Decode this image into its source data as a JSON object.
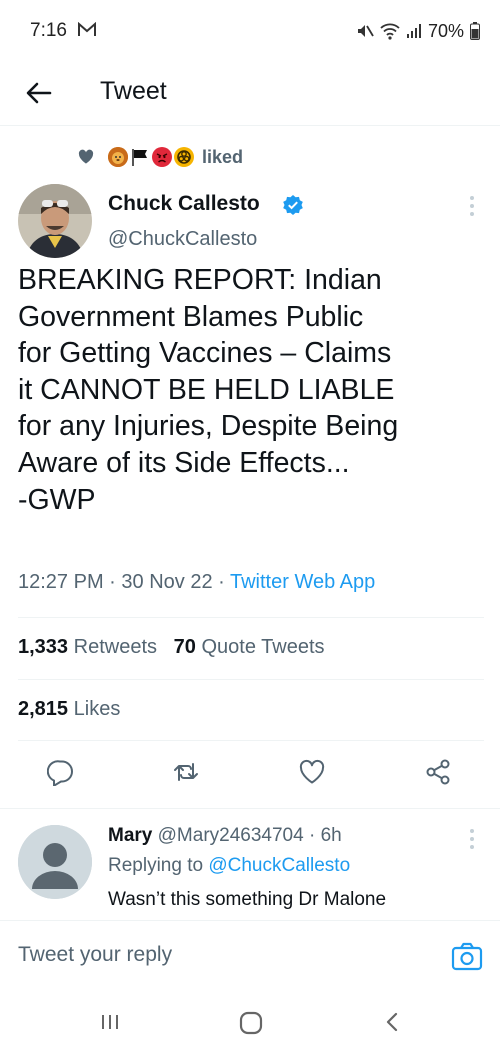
{
  "status_bar": {
    "time": "7:16",
    "battery": "70%",
    "icons": [
      "gmail-icon",
      "mute-icon",
      "wifi-icon",
      "signal-icon",
      "battery-icon"
    ]
  },
  "header": {
    "title": "Tweet",
    "back_icon": "arrow-left-icon"
  },
  "social_context": {
    "text": "liked",
    "emojis": [
      "lion-face",
      "black-flag",
      "angry-face",
      "biohazard-sign"
    ]
  },
  "tweet": {
    "author_name": "Chuck Callesto",
    "author_handle": "@ChuckCallesto",
    "verified": true,
    "text": "BREAKING REPORT: Indian\nGovernment Blames Public\nfor Getting Vaccines – Claims\nit CANNOT BE HELD LIABLE\nfor any Injuries, Despite Being\nAware of its Side Effects...\n-GWP",
    "time": "12:27 PM",
    "date": "30 Nov 22",
    "source": "Twitter Web App",
    "retweets_count": "1,333",
    "retweets_label": "Retweets",
    "quotes_count": "70",
    "quotes_label": "Quote Tweets",
    "likes_count": "2,815",
    "likes_label": "Likes"
  },
  "actions": [
    "reply-icon",
    "retweet-icon",
    "like-icon",
    "share-icon"
  ],
  "reply": {
    "name": "Mary",
    "handle": "@Mary24634704",
    "time": "6h",
    "replying_label": "Replying to",
    "replying_to": "@ChuckCallesto",
    "text": "Wasn’t this something Dr Malone"
  },
  "compose": {
    "placeholder": "Tweet your reply"
  },
  "colors": {
    "accent": "#1d9bf0",
    "secondary_text": "#536471",
    "primary_text": "#0f1419"
  }
}
